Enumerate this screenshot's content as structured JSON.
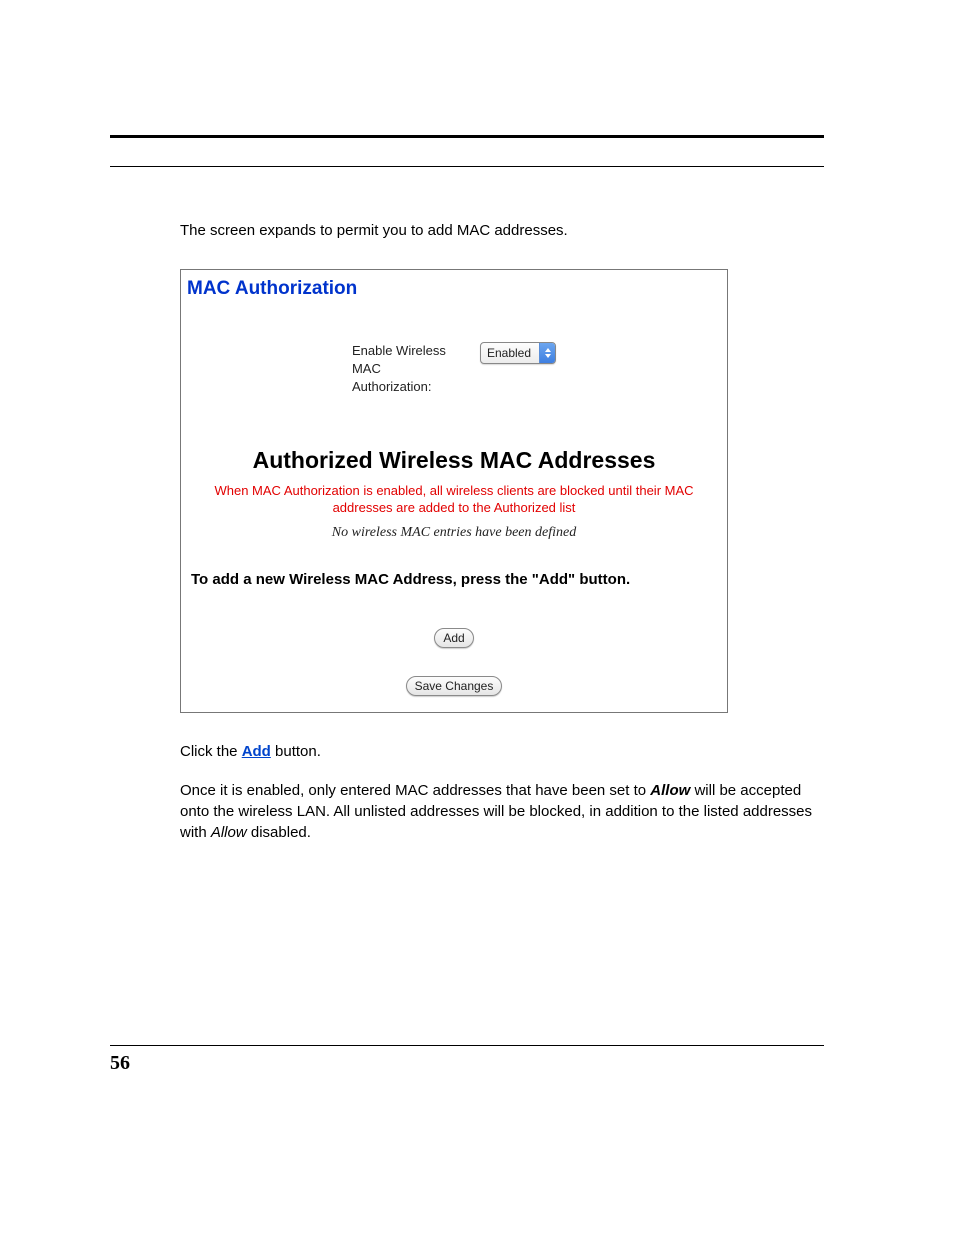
{
  "intro": "The screen expands to permit you to add MAC addresses.",
  "panel": {
    "title": "MAC Authorization",
    "field": {
      "label": "Enable Wireless MAC Authorization:",
      "value": "Enabled"
    },
    "subheading": "Authorized Wireless MAC Addresses",
    "warning": "When MAC Authorization is enabled, all wireless clients are blocked until their MAC addresses are added to the Authorized list",
    "no_entries": "No wireless MAC entries have been defined",
    "instruction": "To add a new Wireless MAC Address, press the \"Add\" button.",
    "buttons": {
      "add": "Add",
      "save": "Save Changes"
    }
  },
  "post": {
    "p1_before": "Click the ",
    "p1_link": "Add",
    "p1_after": " button.",
    "p2_a": "Once it is enabled, only entered MAC addresses that have been set to ",
    "p2_allow1": "Allow",
    "p2_b": " will be accepted onto the wireless LAN. All unlisted addresses will be blocked, in addition to the listed addresses with ",
    "p2_allow2": "Allow",
    "p2_c": " disabled."
  },
  "page_number": "56"
}
